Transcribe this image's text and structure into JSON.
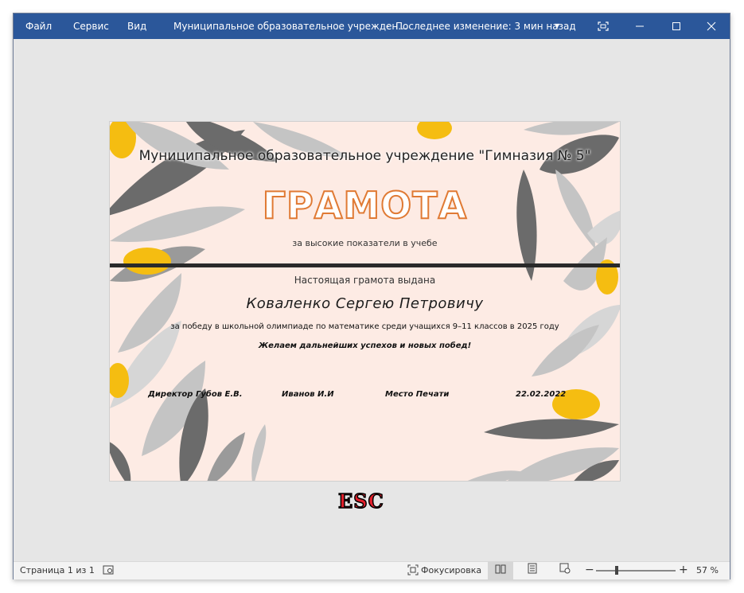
{
  "titlebar": {
    "menu_file": "Файл",
    "menu_service": "Сервис",
    "menu_view": "Вид",
    "doc_title": "Муниципальное образовательное учрежден...",
    "separator": "-",
    "last_change": "Последнее изменение: 3 мин назад",
    "dropdown_icon": "chevron-down-icon",
    "buttons": [
      "focus-mode-icon",
      "minimize-icon",
      "maximize-icon",
      "close-icon"
    ]
  },
  "certificate": {
    "school": "Муниципальное образовательное учреждение \"Гимназия № 5\"",
    "heading": "ГРАМОТА",
    "subtitle": "за высокие показатели в учебе",
    "given": "Настоящая грамота выдана",
    "name": "Коваленко Сергею Петровичу",
    "reason": "за победу в школьной олимпиаде по математике среди учащихся 9–11 классов в 2025 году",
    "wish": "Желаем дальнейших успехов и новых побед!",
    "director": "Директор Губов Е.В.",
    "teacher": "Иванов И.И",
    "stamp": "Место Печати",
    "date": "22.02.2022",
    "colors": {
      "background": "#fdebe4",
      "leaf_dark": "#6b6b6b",
      "leaf_light": "#c4c4c4",
      "accent": "#f5bd11",
      "heading_outline": "#e07a34"
    }
  },
  "overlay": {
    "esc_label": "ESC"
  },
  "statusbar": {
    "page_info": "Страница 1 из 1",
    "focus_label": "Фокусировка",
    "zoom_minus": "−",
    "zoom_plus": "+",
    "zoom": "57 %",
    "zoom_level": 0.57
  }
}
